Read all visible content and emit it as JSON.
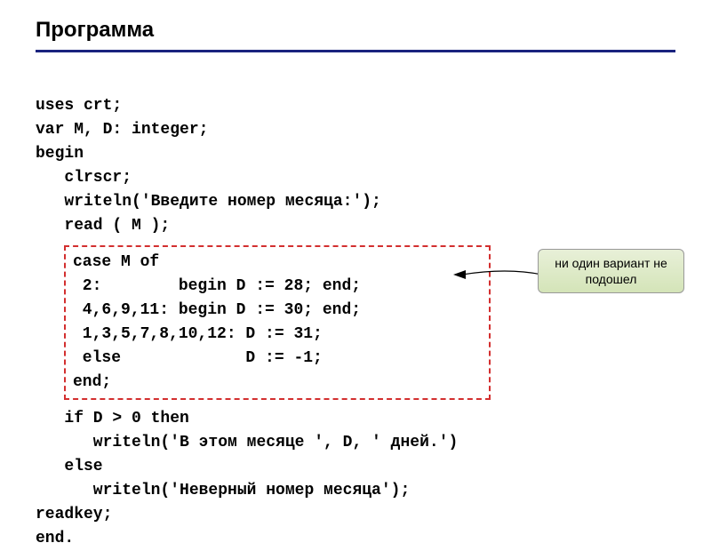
{
  "title": "Программа",
  "code": {
    "line1": "uses crt;",
    "line2": "var M, D: integer;",
    "line3": "begin",
    "line4": "   clrscr;",
    "line5": "   writeln('Введите номер месяца:');",
    "line6": "   read ( M );",
    "box1": "case M of",
    "box2": " 2:        begin D := 28; end;",
    "box3": " 4,6,9,11: begin D := 30; end;",
    "box4": " 1,3,5,7,8,10,12: D := 31;",
    "box5": " else             D := -1;",
    "box6": "end;",
    "line7": "   if D > 0 then",
    "line8": "      writeln('В этом месяце ', D, ' дней.')",
    "line9": "   else",
    "line10": "      writeln('Неверный номер месяца');",
    "line11": "readkey;",
    "line12": "end."
  },
  "callout": "ни один вариант не подошел"
}
